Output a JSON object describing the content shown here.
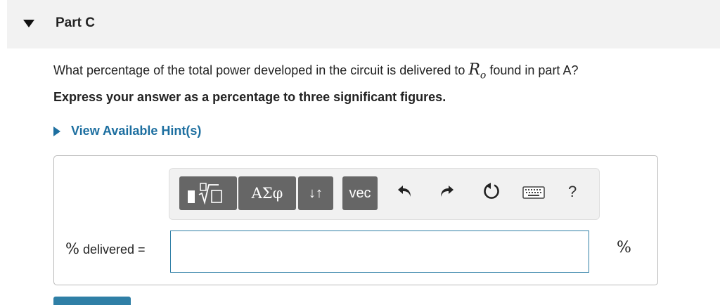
{
  "part": {
    "title": "Part C"
  },
  "question": {
    "text_before": "What percentage of the total power developed in the circuit is delivered to ",
    "variable": "R",
    "variable_sub": "o",
    "text_after": " found in part A?"
  },
  "instruction": "Express your answer as a percentage to three significant figures.",
  "hint": {
    "label": "View Available Hint(s)"
  },
  "toolbar": {
    "templates_icon": "templates-sqrt-icon",
    "greek_label": "ΑΣφ",
    "arrows_label": "↓↑",
    "vec_label": "vec",
    "undo_icon": "undo-icon",
    "redo_icon": "redo-icon",
    "reset_icon": "reset-icon",
    "keyboard_icon": "keyboard-icon",
    "help_label": "?"
  },
  "answer": {
    "label_symbol": "%",
    "label_text": " delivered =",
    "value": "",
    "unit": "%"
  },
  "colors": {
    "header_bg": "#f2f2f2",
    "hint_link": "#1d6fa0",
    "input_border": "#2f7fa6",
    "toolbar_button": "#666666"
  }
}
